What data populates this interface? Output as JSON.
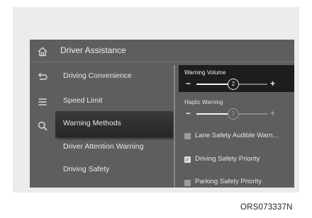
{
  "header": {
    "title": "Driver Assistance"
  },
  "rail": {
    "icons": [
      "home-icon",
      "back-icon",
      "menu-icon",
      "search-icon"
    ]
  },
  "menu": {
    "items": [
      {
        "label": "Driving Convenience",
        "selected": false
      },
      {
        "label": "Speed Limit",
        "selected": false
      },
      {
        "label": "Warning Methods",
        "selected": true
      },
      {
        "label": "Driver Attention Warning",
        "selected": false
      },
      {
        "label": "Driving Safety",
        "selected": false
      }
    ]
  },
  "settings": {
    "warning_volume": {
      "label": "Warning Volume",
      "value": "2",
      "level": 2,
      "max": 3,
      "minus": "−",
      "plus": "+"
    },
    "haptic_warning": {
      "label": "Haptic Warning",
      "value": "2",
      "level": 2,
      "max": 3,
      "minus": "−",
      "plus": "+",
      "enabled": false
    },
    "checkboxes": [
      {
        "label": "Lane Safety Audible Warn...",
        "checked": false
      },
      {
        "label": "Driving Safety Priority",
        "checked": true
      },
      {
        "label": "Parking Safety Priority",
        "checked": false
      }
    ]
  },
  "caption": "ORS073337N",
  "colors": {
    "selected_bg": "#2b2b2b",
    "panel_bg": "#5e5e5e",
    "volume_card_bg": "#1d1d1d"
  }
}
